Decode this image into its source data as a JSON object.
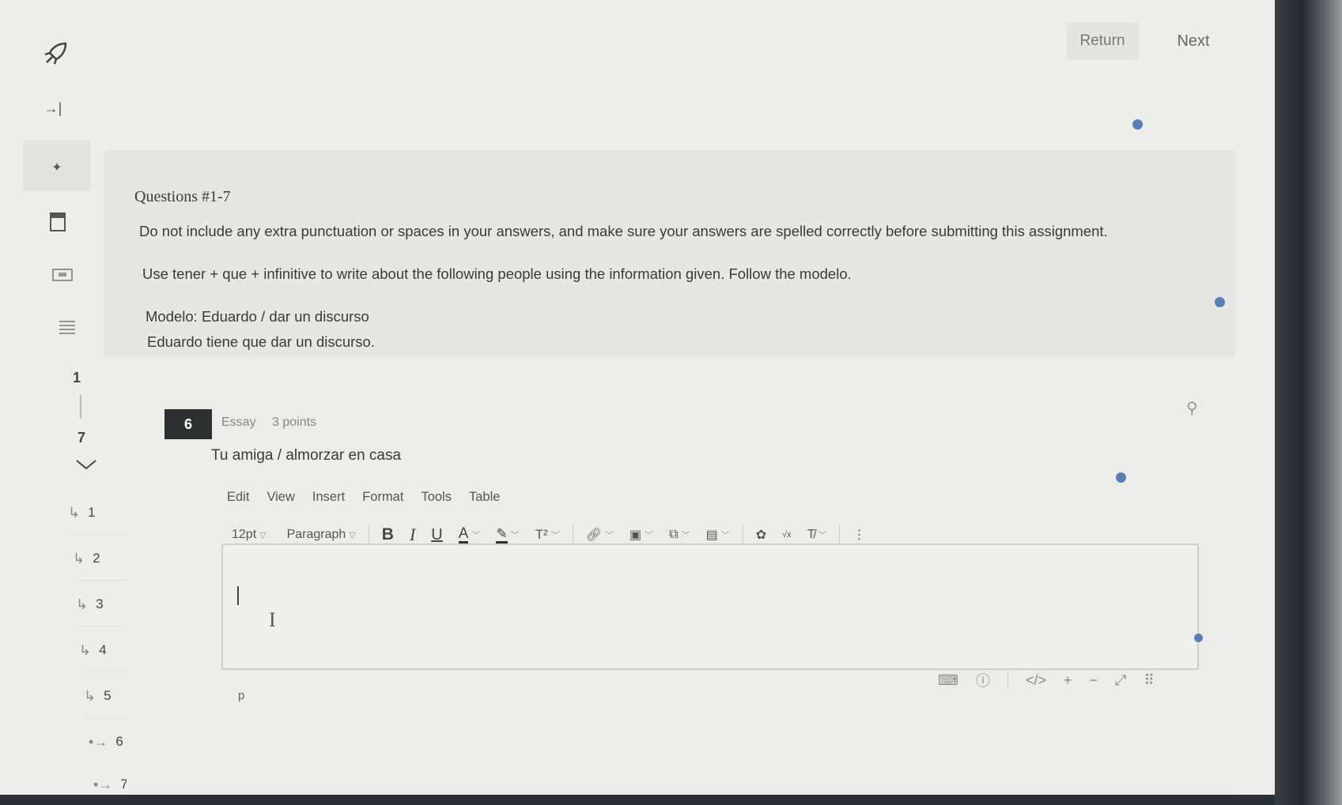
{
  "topnav": {
    "return_label": "Return",
    "next_label": "Next"
  },
  "rail": {
    "icons": [
      "rocket-icon",
      "collapse-icon",
      "pin-icon",
      "calculator-icon",
      "keyboard-icon",
      "notes-icon"
    ],
    "range_start": "1",
    "range_end": "7",
    "questions": [
      {
        "arrow": "↳",
        "num": "1"
      },
      {
        "arrow": "↳",
        "num": "2"
      },
      {
        "arrow": "↳",
        "num": "3"
      },
      {
        "arrow": "↳",
        "num": "4"
      },
      {
        "arrow": "↳",
        "num": "5"
      },
      {
        "arrow": "•→",
        "num": "6"
      },
      {
        "arrow": "•→",
        "num": "7"
      }
    ]
  },
  "instructions": {
    "title": "Questions #1-7",
    "line1": "Do not include any extra punctuation or spaces in your answers, and make sure your answers are spelled correctly before submitting this assignment.",
    "line2": "Use tener + que + infinitive to write about the following people using the information given. Follow the modelo.",
    "modelo_prompt": "Modelo: Eduardo / dar un discurso",
    "modelo_answer": "Eduardo tiene que dar un discurso."
  },
  "question": {
    "number": "6",
    "type": "Essay",
    "points": "3 points",
    "prompt": "Tu amiga / almorzar en casa"
  },
  "editor": {
    "menu": [
      "Edit",
      "View",
      "Insert",
      "Format",
      "Tools",
      "Table"
    ],
    "font_size": "12pt",
    "block_format": "Paragraph",
    "bold": "B",
    "italic": "I",
    "underline": "U",
    "text_color": "A",
    "superscript": "T²",
    "path": "p",
    "content": ""
  },
  "colors": {
    "accent_dot": "#5b7fb3",
    "badge_bg": "#2e2f31"
  }
}
